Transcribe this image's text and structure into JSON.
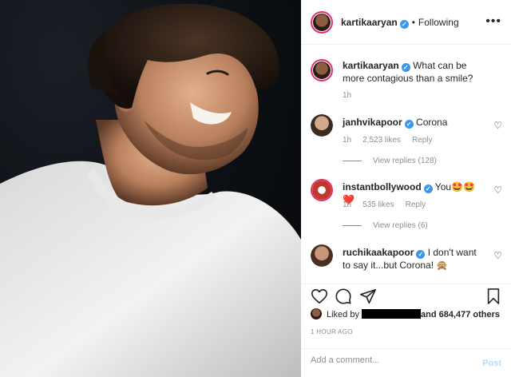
{
  "header": {
    "username": "kartikaaryan",
    "separator": "•",
    "follow_status": "Following",
    "more": "•••"
  },
  "caption": {
    "username": "kartikaaryan",
    "text": "What can be more contagious than a smile?",
    "age": "1h"
  },
  "comments": [
    {
      "username": "janhvikapoor",
      "text": "Corona",
      "age": "1h",
      "likes": "2,523 likes",
      "reply": "Reply",
      "view_replies": "View replies (128)"
    },
    {
      "username": "instantbollywood",
      "text": "You🤩🤩❤️",
      "age": "1h",
      "likes": "535 likes",
      "reply": "Reply",
      "view_replies": "View replies (6)"
    },
    {
      "username": "ruchikaakapoor",
      "text": "I don't want to say it...but Corona! 🙊"
    }
  ],
  "likes": {
    "prefix": "Liked by",
    "suffix": "and 684,477 others"
  },
  "timestamp": "1 HOUR AGO",
  "add_comment": {
    "placeholder": "Add a comment...",
    "post_label": "Post"
  },
  "icons": {
    "like": "heart-icon",
    "comment": "comment-icon",
    "share": "send-icon",
    "save": "bookmark-icon",
    "verified": "verified-badge-icon",
    "more": "more-options-icon"
  },
  "colors": {
    "verified": "#3897f0",
    "muted": "#8e8e8e",
    "post_disabled": "#b3dbff",
    "story_ring": "#e1306c"
  }
}
